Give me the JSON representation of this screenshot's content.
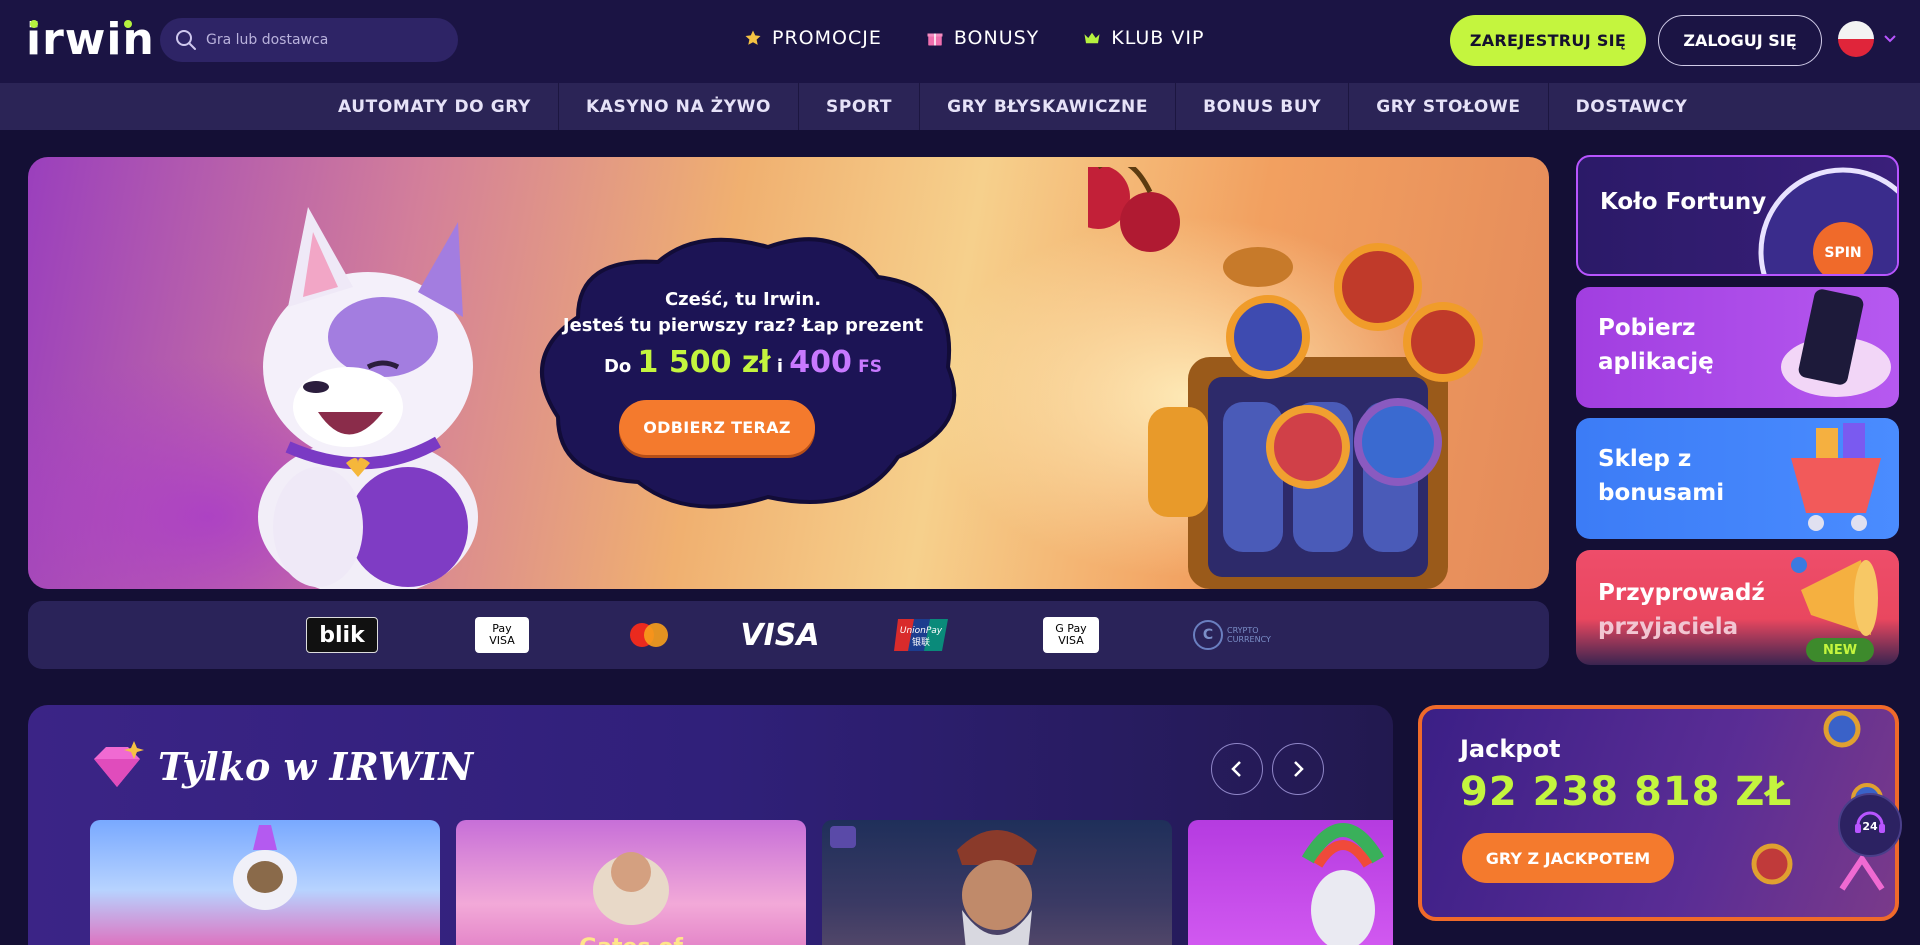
{
  "header": {
    "logo": "irwin",
    "search_placeholder": "Gra lub dostawca",
    "nav": [
      {
        "label": "PROMOCJE",
        "icon": "star-icon"
      },
      {
        "label": "BONUSY",
        "icon": "gift-icon"
      },
      {
        "label": "KLUB VIP",
        "icon": "crown-icon"
      }
    ],
    "register_label": "ZAREJESTRUJ SIĘ",
    "login_label": "ZALOGUJ SIĘ",
    "language_flag": "flag-poland-icon"
  },
  "categories": [
    "AUTOMATY DO GRY",
    "KASYNO NA ŻYWO",
    "SPORT",
    "GRY BŁYSKAWICZNE",
    "BONUS BUY",
    "GRY STOŁOWE",
    "DOSTAWCY"
  ],
  "hero": {
    "greeting": "Cześć, tu Irwin.",
    "line2": "Jesteś tu pierwszy raz? Łap prezent",
    "prefix": "Do",
    "amount": "1 500 zł",
    "connector": "i",
    "spins": "400",
    "spins_unit": "FS",
    "cta": "ODBIERZ TERAZ"
  },
  "payments": {
    "blik": "blik",
    "apple_top": "Pay",
    "apple_bottom": "VISA",
    "visa": "VISA",
    "union_top": "UnionPay",
    "union_bottom": "银联",
    "gpay_top": "G Pay",
    "gpay_bottom": "VISA",
    "crypto_symbol": "C",
    "crypto_label": "CRYPTO CURRENCY"
  },
  "side_cards": {
    "wheel": "Koło Fortuny",
    "wheel_spin": "SPIN",
    "app_line1": "Pobierz",
    "app_line2": "aplikację",
    "shop_line1": "Sklep z",
    "shop_line2": "bonusami",
    "friend_line1": "Przyprowadź",
    "friend_line2": "przyjaciela",
    "new_badge": "NEW"
  },
  "games": {
    "title": "Tylko w IRWIN",
    "cards": [
      {
        "title": ""
      },
      {
        "title": "Gates of"
      },
      {
        "title": ""
      },
      {
        "title": ""
      }
    ]
  },
  "jackpot": {
    "label": "Jackpot",
    "value": "92 238 818 ZŁ",
    "cta": "GRY Z JACKPOTEM"
  },
  "support": {
    "label": "24"
  },
  "colors": {
    "background": "#140f35",
    "accent_green": "#c4f53e",
    "accent_orange": "#f47a2d",
    "accent_purple": "#b855ff"
  }
}
